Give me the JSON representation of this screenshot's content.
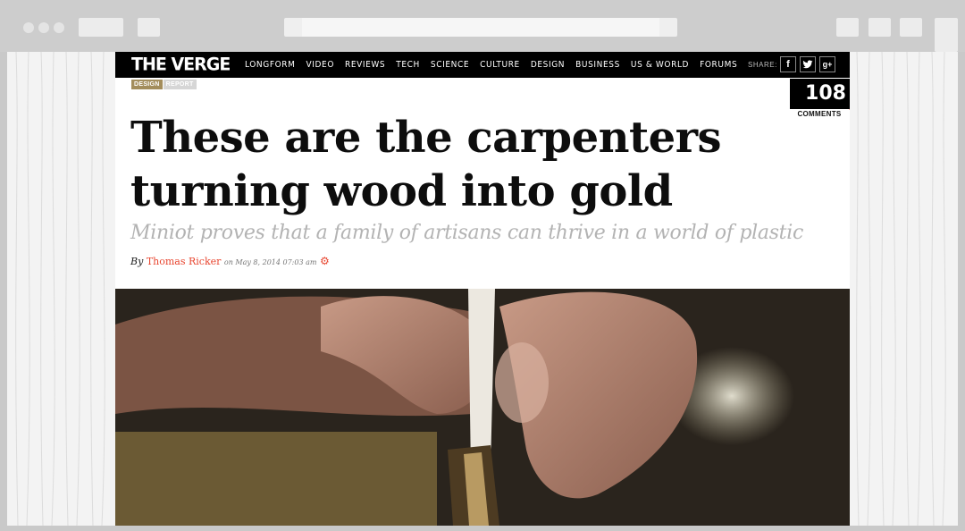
{
  "site": {
    "logo": "THE VERGE",
    "nav": [
      "LONGFORM",
      "VIDEO",
      "REVIEWS",
      "TECH",
      "SCIENCE",
      "CULTURE",
      "DESIGN",
      "BUSINESS",
      "US & WORLD",
      "FORUMS"
    ],
    "share_label": "SHARE:",
    "share_icons": [
      "f",
      "t",
      "g+"
    ]
  },
  "article": {
    "tags": [
      "DESIGN",
      "REPORT"
    ],
    "comments_count": "108",
    "comments_label": "COMMENTS",
    "headline_line1": "These are the carpenters",
    "headline_line2": "turning wood into gold",
    "subhead": "Miniot proves that a family of artisans can thrive in a world of plastic",
    "by": "By",
    "author": "Thomas Ricker",
    "date": "on May 8, 2014 07:03 am"
  },
  "colors": {
    "accent": "#e8452f",
    "tag_design": "#a38d5c",
    "tag_report": "#d6d6d6"
  }
}
